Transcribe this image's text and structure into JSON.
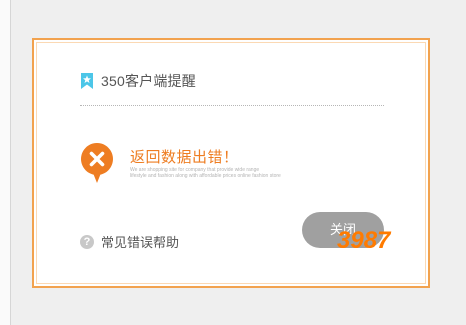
{
  "dialog": {
    "title": "350客户端提醒",
    "header_icon": "bookmark-star-icon",
    "error_icon": "close-x-pin-icon",
    "message_title": "返回数据出错！",
    "message_sub_1": "We are shopping site for company that provide wide range",
    "message_sub_2": "lifestyle and fashion along with affordable prices online fashion store",
    "help_icon": "question-circle-icon",
    "help_label": "常见错误帮助",
    "close_label": "关闭"
  },
  "watermark": "3987",
  "colors": {
    "accent": "#f2a24e",
    "error": "#ee7d22",
    "button": "#a0a0a0",
    "header_icon": "#4cc6e8"
  }
}
